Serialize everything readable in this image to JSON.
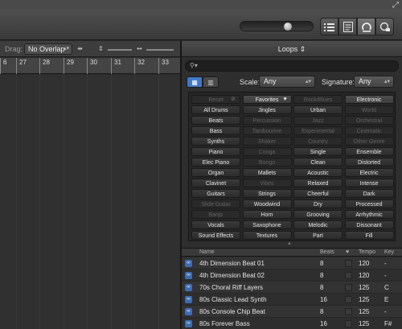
{
  "toolbar": {
    "buttons": [
      "list-editors",
      "note-pad",
      "loop-browser",
      "browsers"
    ]
  },
  "tracks": {
    "drag_label": "Drag:",
    "drag_value": "No Overlap",
    "ruler_bars": [
      "6",
      "27",
      "28",
      "29",
      "30",
      "31",
      "32",
      "33"
    ]
  },
  "loops": {
    "title": "Loops",
    "search_placeholder": "",
    "scale_label": "Scale:",
    "scale_value": "Any",
    "signature_label": "Signature:",
    "signature_value": "Any",
    "keywords": [
      [
        "Reset",
        "Favorites",
        "Rock/Blues",
        "Electronic"
      ],
      [
        "All Drums",
        "Jingles",
        "Urban",
        "World"
      ],
      [
        "Beats",
        "Percussion",
        "Jazz",
        "Orchestral"
      ],
      [
        "Bass",
        "Tambourine",
        "Experimental",
        "Cinematic"
      ],
      [
        "Synths",
        "Shaker",
        "Country",
        "Other Genre"
      ],
      [
        "Piano",
        "Conga",
        "Single",
        "Ensemble"
      ],
      [
        "Elec Piano",
        "Bongo",
        "Clean",
        "Distorted"
      ],
      [
        "Organ",
        "Mallets",
        "Acoustic",
        "Electric"
      ],
      [
        "Clavinet",
        "Vibes",
        "Relaxed",
        "Intense"
      ],
      [
        "Guitars",
        "Strings",
        "Cheerful",
        "Dark"
      ],
      [
        "Slide Guitar",
        "Woodwind",
        "Dry",
        "Processed"
      ],
      [
        "Banjo",
        "Horn",
        "Grooving",
        "Arrhythmic"
      ],
      [
        "Vocals",
        "Saxophone",
        "Melodic",
        "Dissonant"
      ],
      [
        "Sound Effects",
        "Textures",
        "Part",
        "Fill"
      ]
    ],
    "keyword_disabled": [
      [
        true,
        false,
        true,
        false
      ],
      [
        false,
        false,
        false,
        true
      ],
      [
        false,
        true,
        true,
        true
      ],
      [
        false,
        true,
        true,
        true
      ],
      [
        false,
        true,
        true,
        true
      ],
      [
        false,
        true,
        false,
        false
      ],
      [
        false,
        true,
        false,
        false
      ],
      [
        false,
        false,
        false,
        false
      ],
      [
        false,
        true,
        false,
        false
      ],
      [
        false,
        false,
        false,
        false
      ],
      [
        true,
        false,
        false,
        false
      ],
      [
        true,
        false,
        false,
        false
      ],
      [
        false,
        false,
        false,
        false
      ],
      [
        false,
        false,
        false,
        false
      ]
    ],
    "columns": {
      "name": "Name",
      "beats": "Beats",
      "fav": "♥",
      "tempo": "Tempo",
      "key": "Key"
    },
    "results": [
      {
        "name": "4th Dimension Beat 01",
        "beats": "8",
        "tempo": "120",
        "key": "-"
      },
      {
        "name": "4th Dimension Beat 02",
        "beats": "8",
        "tempo": "120",
        "key": "-"
      },
      {
        "name": "70s Choral Riff Layers",
        "beats": "8",
        "tempo": "125",
        "key": "C"
      },
      {
        "name": "80s Classic Lead Synth",
        "beats": "16",
        "tempo": "125",
        "key": "E"
      },
      {
        "name": "80s Console Chip Beat",
        "beats": "8",
        "tempo": "125",
        "key": "-"
      },
      {
        "name": "80s Forever Bass",
        "beats": "16",
        "tempo": "125",
        "key": "F#"
      }
    ]
  }
}
